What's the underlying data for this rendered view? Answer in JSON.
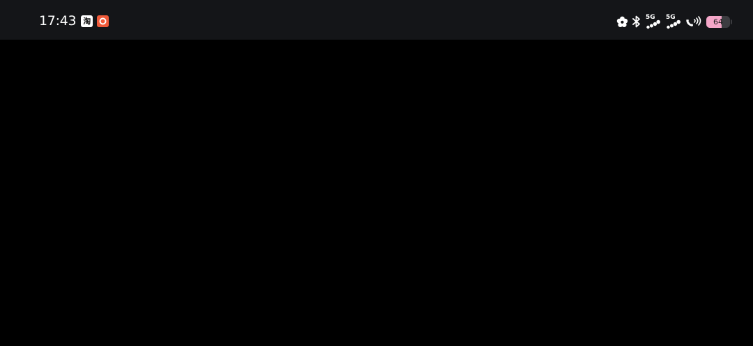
{
  "status_bar": {
    "time": "17:43",
    "notifications": [
      {
        "icon": "taobao-app-icon",
        "glyph": "淘"
      },
      {
        "icon": "screen-record-icon"
      }
    ],
    "system_icons": [
      "flower-icon",
      "bluetooth-icon",
      "cellular-signal-icon",
      "cellular-signal-icon",
      "wifi-calling-icon"
    ],
    "sim1_network": "5G",
    "sim2_network": "5G",
    "battery": {
      "level_text": "64",
      "level_fraction": 0.64,
      "color": "#f4a6c8"
    }
  },
  "colors": {
    "status_bar_bg": "#141518",
    "screen_bg": "#000000",
    "record_badge": "#f05a3a"
  }
}
